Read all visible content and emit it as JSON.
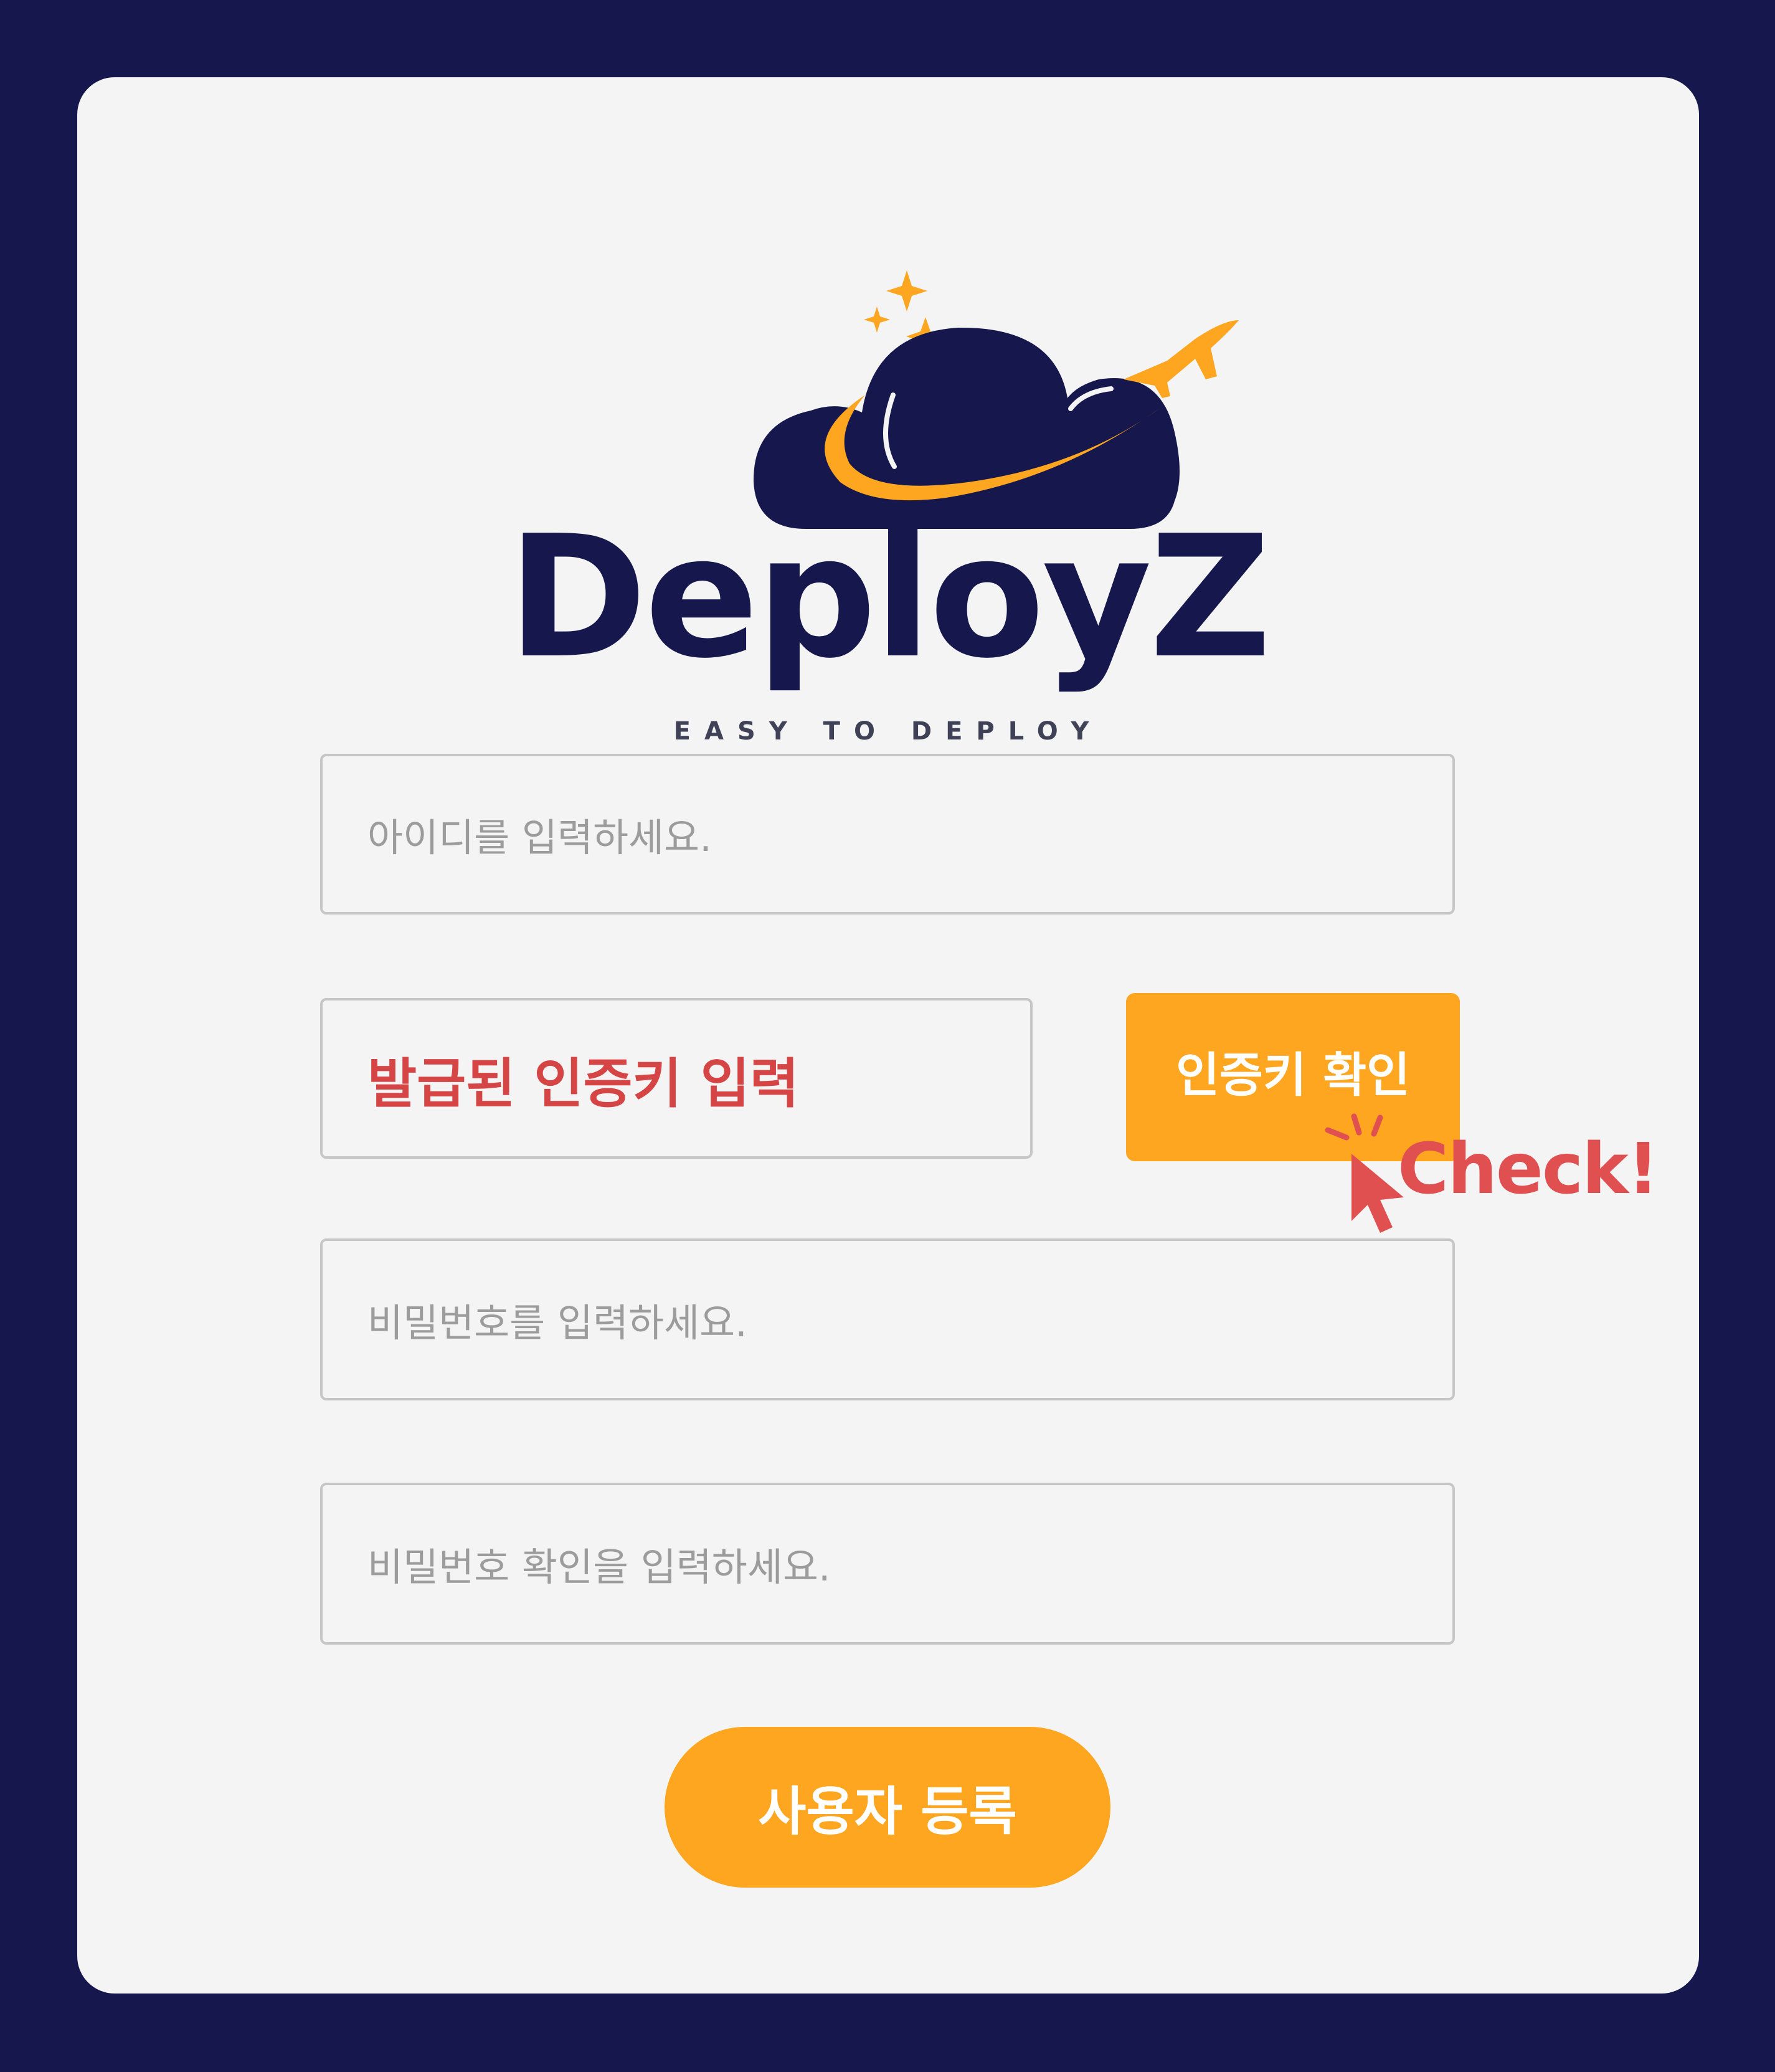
{
  "brand": {
    "name": "DeployZ",
    "tagline": "EASY TO DEPLOY"
  },
  "form": {
    "id_placeholder": "아이디를 입력하세요.",
    "key_value": "발급된 인증키 입력",
    "verify_button": "인증키 확인",
    "password_placeholder": "비밀번호를 입력하세요.",
    "password_confirm_placeholder": "비밀번호 확인을 입력하세요.",
    "register_button": "사용자 등록"
  },
  "annotation": {
    "check_text": "Check!",
    "icon": "cursor-click-icon"
  },
  "colors": {
    "background": "#16174d",
    "card": "#f4f4f4",
    "accent": "#ffa620",
    "highlight_red": "#d64545"
  }
}
